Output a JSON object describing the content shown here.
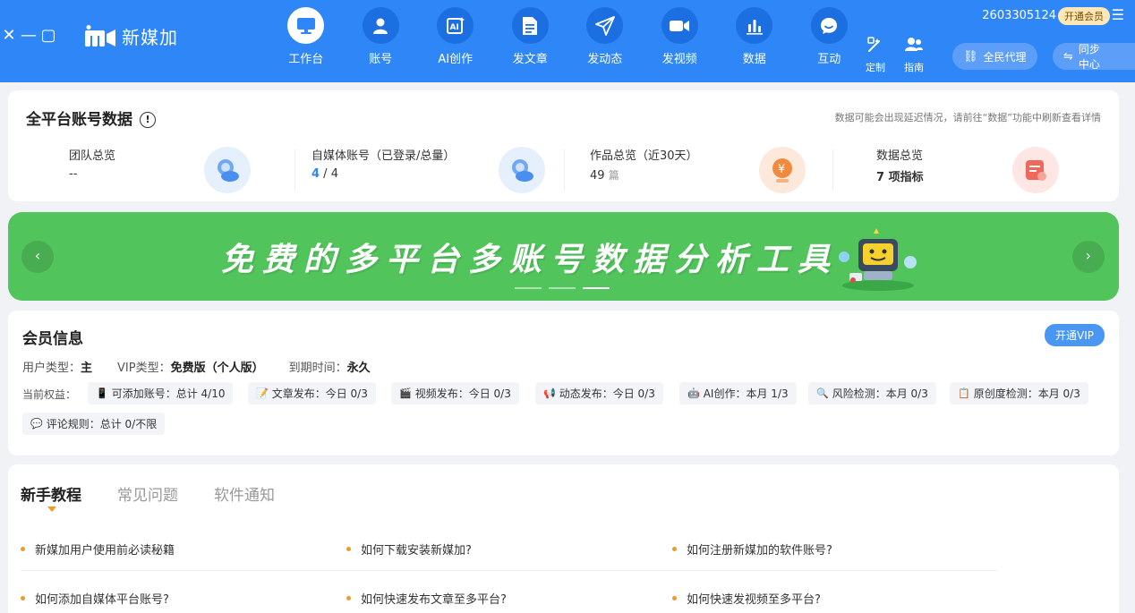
{
  "window": {
    "close": "✕",
    "minimize": "—",
    "maximize": "▢"
  },
  "app": {
    "name": "新媒加"
  },
  "nav": [
    {
      "label": "工作台",
      "icon": "monitor-icon",
      "active": true
    },
    {
      "label": "账号",
      "icon": "user-icon"
    },
    {
      "label": "AI创作",
      "icon": "ai-icon"
    },
    {
      "label": "发文章",
      "icon": "document-icon"
    },
    {
      "label": "发动态",
      "icon": "paper-plane-icon"
    },
    {
      "label": "发视频",
      "icon": "video-camera-icon"
    },
    {
      "label": "数据",
      "icon": "bar-chart-icon"
    },
    {
      "label": "互动",
      "icon": "chat-bubble-icon"
    }
  ],
  "utility": {
    "custom": "定制",
    "guide": "指南"
  },
  "account": {
    "id": "2603305124",
    "vip_button": "开通会员",
    "agent": "全民代理",
    "sync": "同步中心"
  },
  "stats": {
    "title": "全平台账号数据",
    "note": "数据可能会出现延迟情况，请前往“数据”功能中刷新查看详情",
    "items": [
      {
        "label": "团队总览",
        "value": "--"
      },
      {
        "label": "自媒体账号（已登录/总量）",
        "logged": "4",
        "sep": " / ",
        "total": "4"
      },
      {
        "label": "作品总览（近30天）",
        "count": "49",
        "unit": "篇"
      },
      {
        "label": "数据总览",
        "value": "7 项指标"
      }
    ]
  },
  "banner": {
    "text": "免费的多平台多账号数据分析工具",
    "prev": "‹",
    "next": "›",
    "active_slide": 3,
    "slides": 3
  },
  "member": {
    "title": "会员信息",
    "open_vip": "开通VIP",
    "user_type_label": "用户类型：",
    "user_type": "主",
    "vip_type_label": "VIP类型：",
    "vip_type": "免费版（个人版）",
    "expire_label": "到期时间：",
    "expire": "永久",
    "rights_label": "当前权益：",
    "rights": [
      {
        "icon": "📱",
        "text": "可添加账号：总计 4/10"
      },
      {
        "icon": "📝",
        "text": "文章发布：今日 0/3"
      },
      {
        "icon": "🎬",
        "text": "视频发布：今日 0/3"
      },
      {
        "icon": "📢",
        "text": "动态发布：今日 0/3"
      },
      {
        "icon": "🤖",
        "text": "AI创作：本月 1/3"
      },
      {
        "icon": "🔍",
        "text": "风险检测：本月 0/3"
      },
      {
        "icon": "📋",
        "text": "原创度检测：本月 0/3"
      },
      {
        "icon": "💬",
        "text": "评论规则：总计 0/不限"
      }
    ]
  },
  "help": {
    "tabs": [
      "新手教程",
      "常见问题",
      "软件通知"
    ],
    "articles": [
      "新媒加用户使用前必读秘籍",
      "如何下载安装新媒加?",
      "如何注册新媒加的软件账号?",
      "如何添加自媒体平台账号?",
      "如何快速发布文章至多平台?",
      "如何快速发视频至多平台?"
    ]
  },
  "colors": {
    "brand": "#2f86f6",
    "banner": "#52c45c",
    "accent": "#f09a28"
  }
}
